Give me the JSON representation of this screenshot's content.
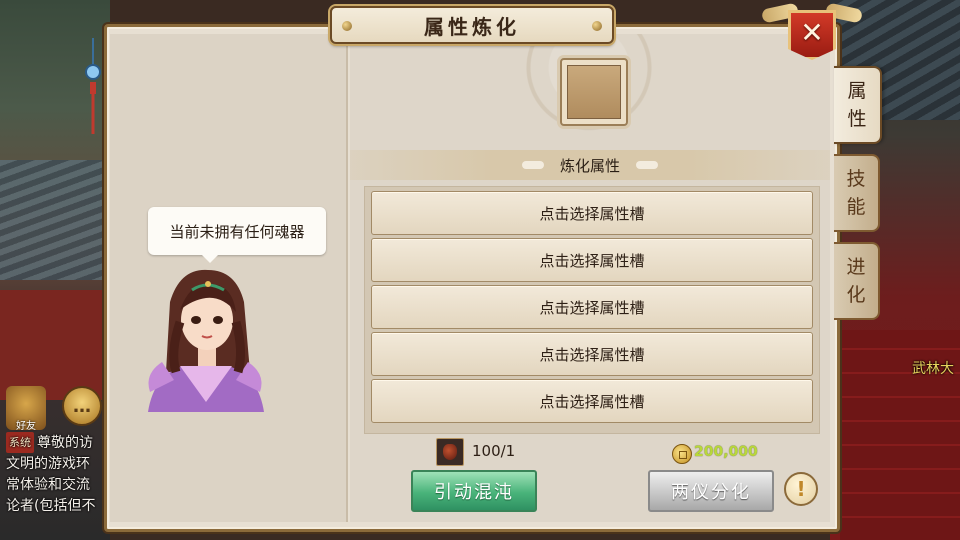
{
  "window": {
    "title": "属性炼化",
    "close_label": "✕"
  },
  "tabs": [
    {
      "label": [
        "属",
        "性"
      ],
      "active": true
    },
    {
      "label": [
        "技",
        "能"
      ],
      "active": false
    },
    {
      "label": [
        "进",
        "化"
      ],
      "active": false
    }
  ],
  "left_panel": {
    "speech": "当前未拥有任何魂器"
  },
  "refine": {
    "section_title": "炼化属性",
    "slots": [
      "点击选择属性槽",
      "点击选择属性槽",
      "点击选择属性槽",
      "点击选择属性槽",
      "点击选择属性槽"
    ]
  },
  "footer": {
    "material_count": "100/1",
    "coin_cost": "200,000",
    "primary_button": "引动混沌",
    "secondary_button": "两仪分化",
    "help_label": "!"
  },
  "background": {
    "npc_name": "武林大",
    "friend_label": "好友",
    "chat": {
      "tag": "系统",
      "lines": [
        "尊敬的访",
        "文明的游戏环",
        "常体验和交流",
        "论者(包括但不"
      ]
    }
  },
  "colors": {
    "primary_button": "#49b37a",
    "secondary_button": "#c8c8c8",
    "close_button": "#c0301f",
    "coin_text": "#b9d83a"
  }
}
